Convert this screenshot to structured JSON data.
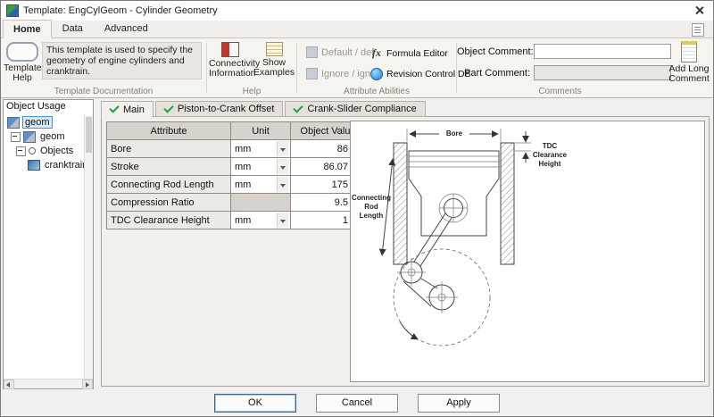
{
  "window": {
    "title": "Template: EngCylGeom - Cylinder Geometry"
  },
  "ribbon": {
    "tabs": [
      {
        "label": "Home"
      },
      {
        "label": "Data"
      },
      {
        "label": "Advanced"
      }
    ],
    "template_documentation": {
      "group_label": "Template Documentation",
      "description": "This template is used to specify the geometry of engine cylinders and cranktrain.",
      "template_help": "Template Help"
    },
    "help": {
      "group_label": "Help",
      "connectivity": "Connectivity Information",
      "examples": "Show Examples"
    },
    "attribute_abilities": {
      "group_label": "Attribute Abilities",
      "default": "Default / def",
      "ignore": "Ignore / ign",
      "formula": "Formula Editor",
      "revision": "Revision Control DB"
    },
    "comments": {
      "group_label": "Comments",
      "object_label": "Object Comment:",
      "object_value": "",
      "part_label": "Part Comment:",
      "part_value": "",
      "add_long": "Add Long Comment"
    }
  },
  "object_usage": {
    "title": "Object Usage",
    "items": [
      {
        "label": "geom"
      },
      {
        "label": "geom"
      },
      {
        "label": "Objects"
      },
      {
        "label": "cranktrain"
      }
    ]
  },
  "doc_tabs": [
    {
      "label": "Main"
    },
    {
      "label": "Piston-to-Crank Offset"
    },
    {
      "label": "Crank-Slider Compliance"
    }
  ],
  "table": {
    "headers": [
      "Attribute",
      "Unit",
      "Object Value"
    ],
    "ellipsis": "...",
    "rows": [
      {
        "attribute": "Bore",
        "unit": "mm",
        "value": "86"
      },
      {
        "attribute": "Stroke",
        "unit": "mm",
        "value": "86.07"
      },
      {
        "attribute": "Connecting Rod Length",
        "unit": "mm",
        "value": "175"
      },
      {
        "attribute": "Compression Ratio",
        "unit": "",
        "value": "9.5"
      },
      {
        "attribute": "TDC Clearance Height",
        "unit": "mm",
        "value": "1"
      }
    ]
  },
  "diagram": {
    "bore": "Bore",
    "tdc1": "TDC",
    "tdc2": "Clearance",
    "tdc3": "Height",
    "rod1": "Connecting",
    "rod2": "Rod",
    "rod3": "Length"
  },
  "footer": {
    "ok": "OK",
    "cancel": "Cancel",
    "apply": "Apply"
  }
}
